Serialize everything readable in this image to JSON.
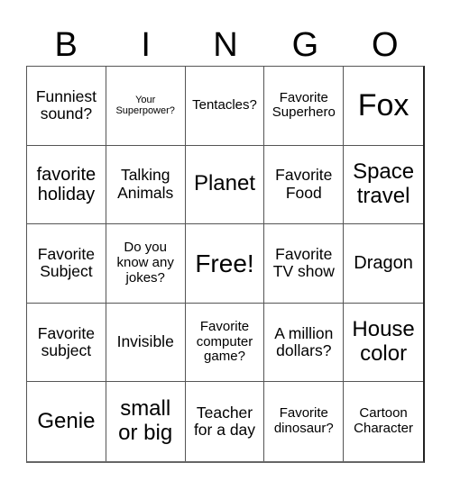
{
  "header": {
    "letters": [
      "B",
      "I",
      "N",
      "G",
      "O"
    ]
  },
  "cells": [
    [
      "Funniest sound?",
      "Your Superpower?",
      "Tentacles?",
      "Favorite Superhero",
      "Fox"
    ],
    [
      "favorite holiday",
      "Talking Animals",
      "Planet",
      "Favorite Food",
      "Space travel"
    ],
    [
      "Favorite Subject",
      "Do you know any jokes?",
      "Free!",
      "Favorite TV show",
      "Dragon"
    ],
    [
      "Favorite subject",
      "Invisible",
      "Favorite computer game?",
      "A million dollars?",
      "House color"
    ],
    [
      "Genie",
      "small or big",
      "Teacher for a day",
      "Favorite dinosaur?",
      "Cartoon Character"
    ]
  ],
  "colors": {
    "text": "#000000",
    "background": "#ffffff",
    "grid_line": "#555555"
  }
}
